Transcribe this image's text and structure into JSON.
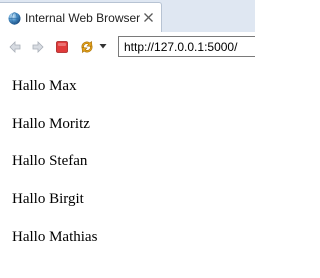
{
  "tab": {
    "title": "Internal Web Browser"
  },
  "toolbar": {
    "back_icon": "back-arrow-icon",
    "forward_icon": "forward-arrow-icon",
    "stop_icon": "stop-icon",
    "refresh_icon": "refresh-icon",
    "menu_icon": "dropdown-triangle-icon",
    "url": "http://127.0.0.1:5000/"
  },
  "content": {
    "greetings": [
      "Hallo Max",
      "Hallo Moritz",
      "Hallo Stefan",
      "Hallo Birgit",
      "Hallo Mathias"
    ]
  },
  "colors": {
    "stop": "#e03a3a",
    "refresh": "#e5a21a",
    "tab_strip": "#dfe7f2"
  }
}
